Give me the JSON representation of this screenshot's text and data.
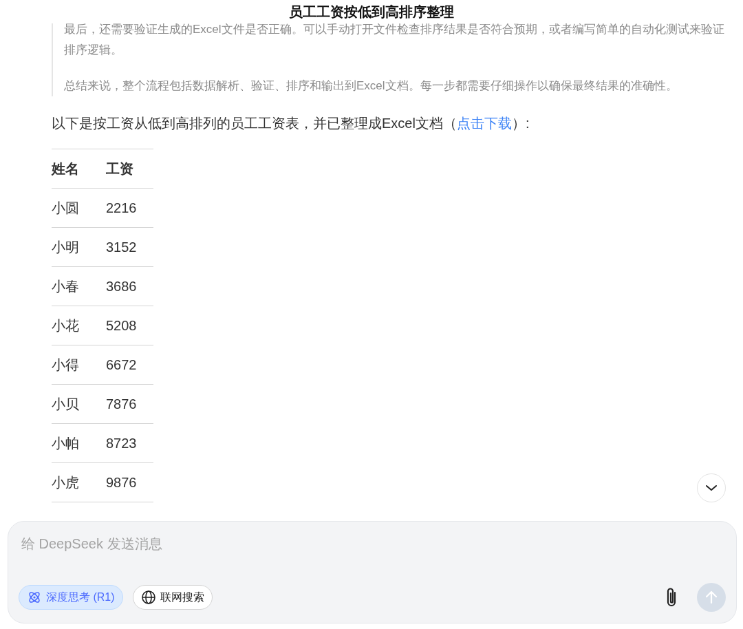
{
  "header": {
    "title": "员工工资按低到高排序整理"
  },
  "quote": {
    "paragraphs": [
      "最后，还需要验证生成的Excel文件是否正确。可以手动打开文件检查排序结果是否符合预期，或者编写简单的自动化测试来验证排序逻辑。",
      "总结来说，整个流程包括数据解析、验证、排序和输出到Excel文档。每一步都需要仔细操作以确保最终结果的准确性。"
    ]
  },
  "intro": {
    "text": "以下是按工资从低到高排列的员工工资表，并已整理成Excel文档（",
    "link": "点击下载",
    "after": "）:"
  },
  "table": {
    "columns": [
      "姓名",
      "工资"
    ],
    "rows": [
      [
        "小圆",
        "2216"
      ],
      [
        "小明",
        "3152"
      ],
      [
        "小春",
        "3686"
      ],
      [
        "小花",
        "5208"
      ],
      [
        "小得",
        "6672"
      ],
      [
        "小贝",
        "7876"
      ],
      [
        "小帕",
        "8723"
      ],
      [
        "小虎",
        "9876"
      ]
    ]
  },
  "composer": {
    "placeholder": "给 DeepSeek 发送消息",
    "toggles": [
      {
        "kind": "deepthink",
        "label": "深度思考 (R1)",
        "selected": true
      },
      {
        "kind": "search",
        "label": "联网搜索",
        "selected": false
      }
    ],
    "send_disabled": true
  }
}
